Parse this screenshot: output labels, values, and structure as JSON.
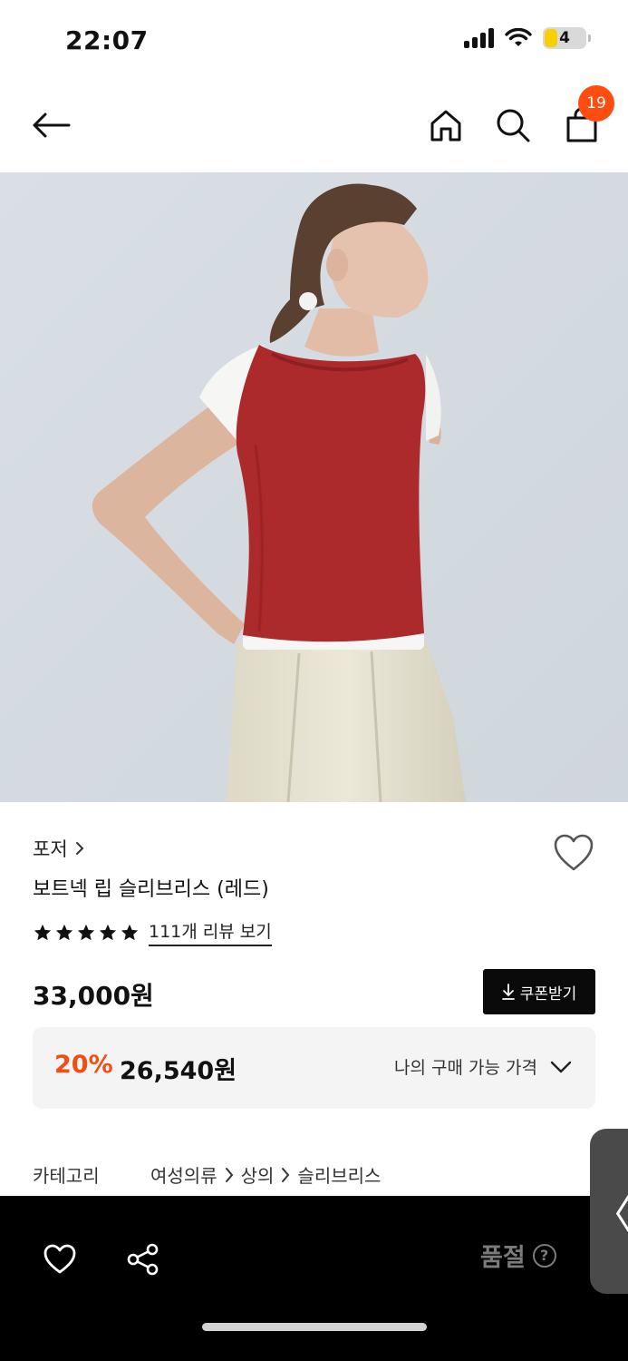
{
  "status_bar": {
    "time": "22:07",
    "battery": "4"
  },
  "header": {
    "cart_count": "19"
  },
  "product": {
    "brand": "포저",
    "name": "보트넥 립 슬리브리스 (레드)",
    "rating_stars": 5,
    "review_link": "111개 리뷰 보기",
    "original_price": "33,000원",
    "coupon_label": "쿠폰받기",
    "discount_rate": "20%",
    "sale_price": "26,540원",
    "my_price_label": "나의 구매 가능 가격"
  },
  "category": {
    "label": "카테고리",
    "path": [
      "여성의류",
      "상의",
      "슬리브리스"
    ]
  },
  "bottom_bar": {
    "soldout_label": "품절",
    "help_symbol": "?"
  },
  "side_handle": {
    "symbol": "〈"
  },
  "colors": {
    "accent_orange": "#f04e13",
    "badge": "#ff4d12",
    "sweater_red": "#b02a2a",
    "bottom_bar": "#000000"
  },
  "icons": [
    "back-arrow-icon",
    "home-icon",
    "search-icon",
    "shopping-bag-icon",
    "heart-icon",
    "star-icon",
    "download-icon",
    "chevron-down-icon",
    "chevron-right-icon",
    "share-icon",
    "help-icon"
  ]
}
